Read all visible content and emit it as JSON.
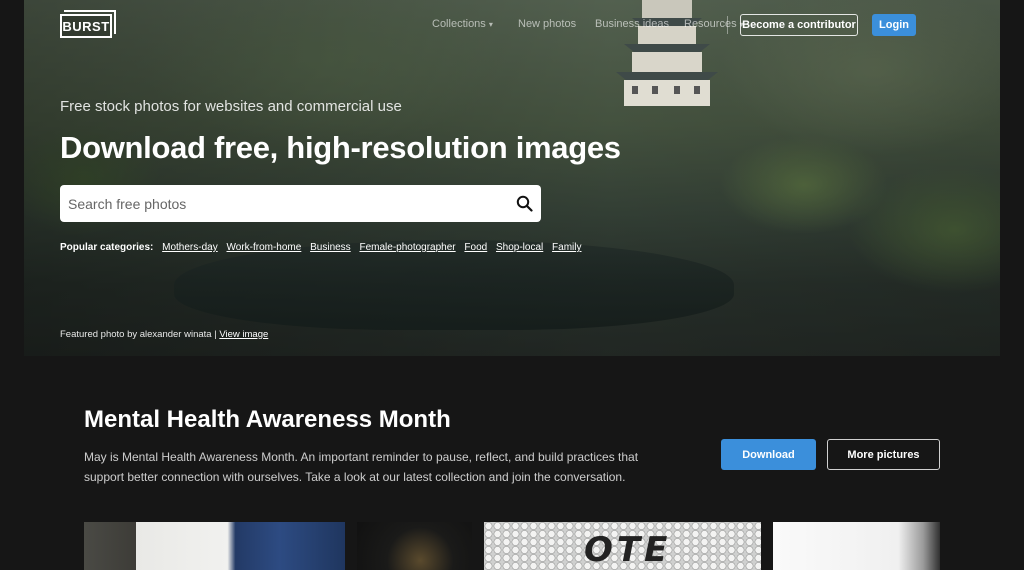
{
  "brand": {
    "logo_text": "BURST"
  },
  "nav": {
    "items": [
      {
        "label": "Collections",
        "has_caret": true
      },
      {
        "label": "New photos",
        "has_caret": false
      },
      {
        "label": "Business ideas",
        "has_caret": false
      },
      {
        "label": "Resources",
        "has_caret": true
      }
    ],
    "contributor_button": "Become a contributor",
    "login_button": "Login"
  },
  "hero": {
    "tagline": "Free stock photos for websites and commercial use",
    "headline": "Download free, high-resolution images",
    "search": {
      "placeholder": "Search free photos",
      "value": ""
    },
    "popular_label": "Popular categories:",
    "categories": [
      "Mothers-day",
      "Work-from-home",
      "Business",
      "Female-photographer",
      "Food",
      "Shop-local",
      "Family"
    ],
    "featured_prefix": "Featured photo by alexander winata |",
    "featured_link": "View image"
  },
  "collection": {
    "title": "Mental Health Awareness Month",
    "description": "May is Mental Health Awareness Month. An important reminder to pause, reflect, and build practices that support better connection with ourselves. Take a look at our latest collection and join the conversation.",
    "download_button": "Download",
    "more_button": "More pictures",
    "thumb_text": "OTE"
  },
  "colors": {
    "accent": "#3b8fdb",
    "background": "#161616"
  },
  "icons": {
    "search": "search-icon",
    "caret": "chevron-down-icon"
  }
}
